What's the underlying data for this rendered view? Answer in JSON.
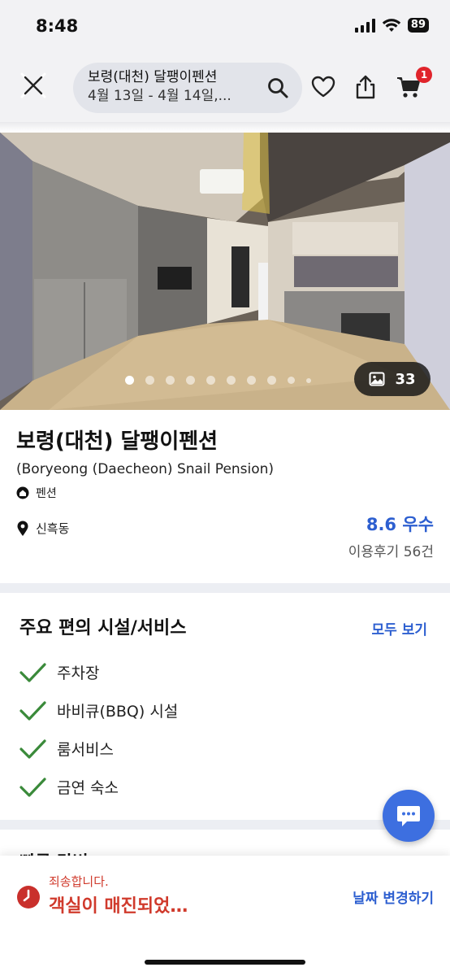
{
  "status_bar": {
    "time": "8:48",
    "battery": "89"
  },
  "header": {
    "search_title": "보령(대천) 달팽이펜션",
    "search_dates": "4월 13일 - 4월 14일,...",
    "cart_count": "1"
  },
  "gallery": {
    "photo_count": "33",
    "dots_total": 10,
    "active_index": 0
  },
  "property": {
    "name": "보령(대천) 달팽이펜션",
    "name_en": "(Boryeong (Daecheon) Snail Pension)",
    "type": "펜션",
    "location": "신흑동",
    "rating": "8.6 우수",
    "reviews": "이용후기 56건"
  },
  "amenities": {
    "title": "주요 편의 시설/서비스",
    "see_all": "모두 보기",
    "items": [
      "주차장",
      "바비큐(BBQ) 시설",
      "룸서비스",
      "금연 숙소"
    ]
  },
  "next_section": {
    "title": "빠른 답변"
  },
  "bottom_bar": {
    "sorry": "죄송합니다.",
    "sold_out": "객실이 매진되었…",
    "change_date": "날짜 변경하기"
  },
  "colors": {
    "accent": "#2d5fd0",
    "alert": "#d03a2c",
    "check": "#3a8a3a",
    "badge": "#e0242b"
  },
  "icons": [
    "close-icon",
    "search-icon",
    "heart-icon",
    "share-icon",
    "cart-icon",
    "image-icon",
    "home-icon",
    "location-pin-icon",
    "check-icon",
    "chat-icon",
    "clock-icon"
  ]
}
